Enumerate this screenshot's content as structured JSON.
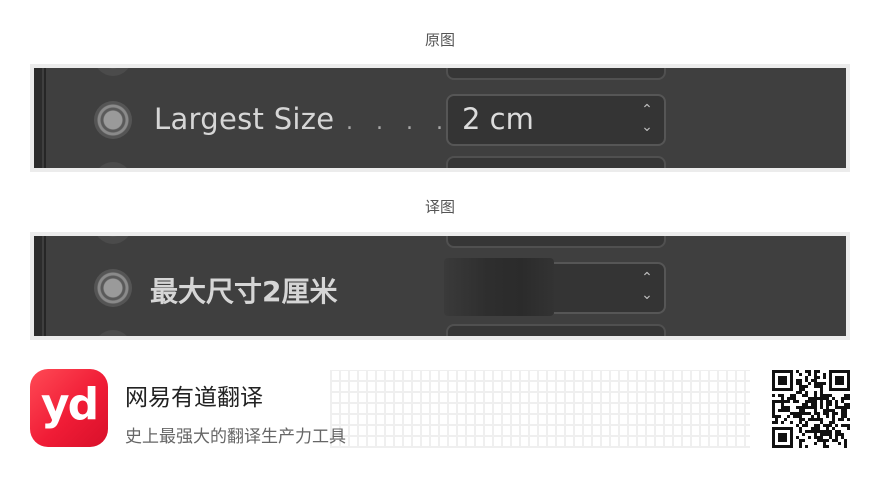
{
  "captions": {
    "original": "原图",
    "translated": "译图"
  },
  "original_panel": {
    "label": "Largest Size",
    "leader_dots": ". . . .",
    "field_value": "2 cm",
    "spinner_up": "⌃",
    "spinner_down": "⌄"
  },
  "translated_panel": {
    "label": "最大尺寸2厘米",
    "spinner_up": "⌃",
    "spinner_down": "⌄"
  },
  "brand": {
    "logo_text": "yd",
    "name": "网易有道翻译",
    "slogan": "史上最强大的翻译生产力工具",
    "logo_color": "#f01c36"
  },
  "colors": {
    "panel_background": "#3f3f3f",
    "text_light": "#d6d6d6"
  }
}
